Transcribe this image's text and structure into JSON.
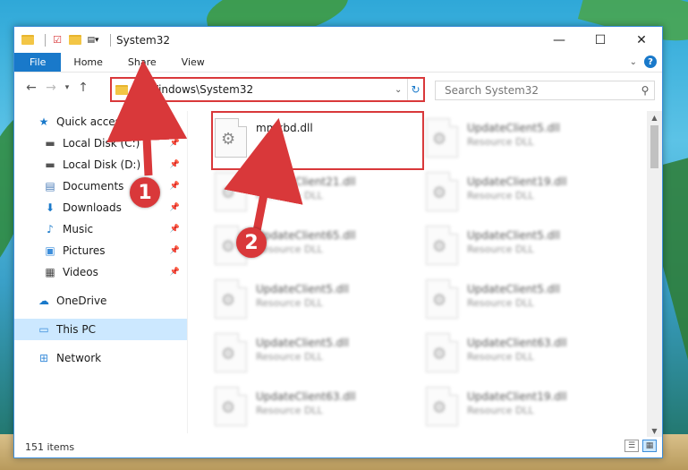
{
  "window": {
    "title": "System32",
    "controls": {
      "minimize": "—",
      "maximize": "☐",
      "close": "✕"
    }
  },
  "ribbon": {
    "tabs": [
      "File",
      "Home",
      "Share",
      "View"
    ]
  },
  "address": {
    "path": "C:\\Windows\\System32",
    "search_placeholder": "Search System32"
  },
  "sidebar": {
    "items": [
      {
        "label": "Quick access",
        "icon": "star-icon",
        "pinned": false
      },
      {
        "label": "Local Disk (C:)",
        "icon": "drive-icon",
        "pinned": true
      },
      {
        "label": "Local Disk (D:)",
        "icon": "drive-icon",
        "pinned": true
      },
      {
        "label": "Documents",
        "icon": "documents-icon",
        "pinned": true
      },
      {
        "label": "Downloads",
        "icon": "downloads-icon",
        "pinned": true
      },
      {
        "label": "Music",
        "icon": "music-icon",
        "pinned": true
      },
      {
        "label": "Pictures",
        "icon": "pictures-icon",
        "pinned": true
      },
      {
        "label": "Videos",
        "icon": "videos-icon",
        "pinned": true
      },
      {
        "label": "OneDrive",
        "icon": "cloud-icon",
        "pinned": false
      },
      {
        "label": "This PC",
        "icon": "computer-icon",
        "pinned": false
      },
      {
        "label": "Network",
        "icon": "network-icon",
        "pinned": false
      }
    ]
  },
  "files": [
    {
      "name": "mmkbd.dll",
      "desc": ""
    },
    {
      "name": "UpdateClient5.dll",
      "desc": "Resource DLL"
    },
    {
      "name": "UpdateClient21.dll",
      "desc": "Resource DLL"
    },
    {
      "name": "UpdateClient19.dll",
      "desc": "Resource DLL"
    },
    {
      "name": "UpdateClient65.dll",
      "desc": "Resource DLL"
    },
    {
      "name": "UpdateClient5.dll",
      "desc": "Resource DLL"
    },
    {
      "name": "UpdateClient5.dll",
      "desc": "Resource DLL"
    },
    {
      "name": "UpdateClient5.dll",
      "desc": "Resource DLL"
    },
    {
      "name": "UpdateClient5.dll",
      "desc": "Resource DLL"
    },
    {
      "name": "UpdateClient63.dll",
      "desc": "Resource DLL"
    },
    {
      "name": "UpdateClient63.dll",
      "desc": "Resource DLL"
    },
    {
      "name": "UpdateClient19.dll",
      "desc": "Resource DLL"
    }
  ],
  "status": {
    "count": "151 items"
  },
  "markers": [
    "1",
    "2"
  ],
  "colors": {
    "accent": "#1979ca",
    "highlight": "#d9383a",
    "selected": "#cce8ff"
  }
}
